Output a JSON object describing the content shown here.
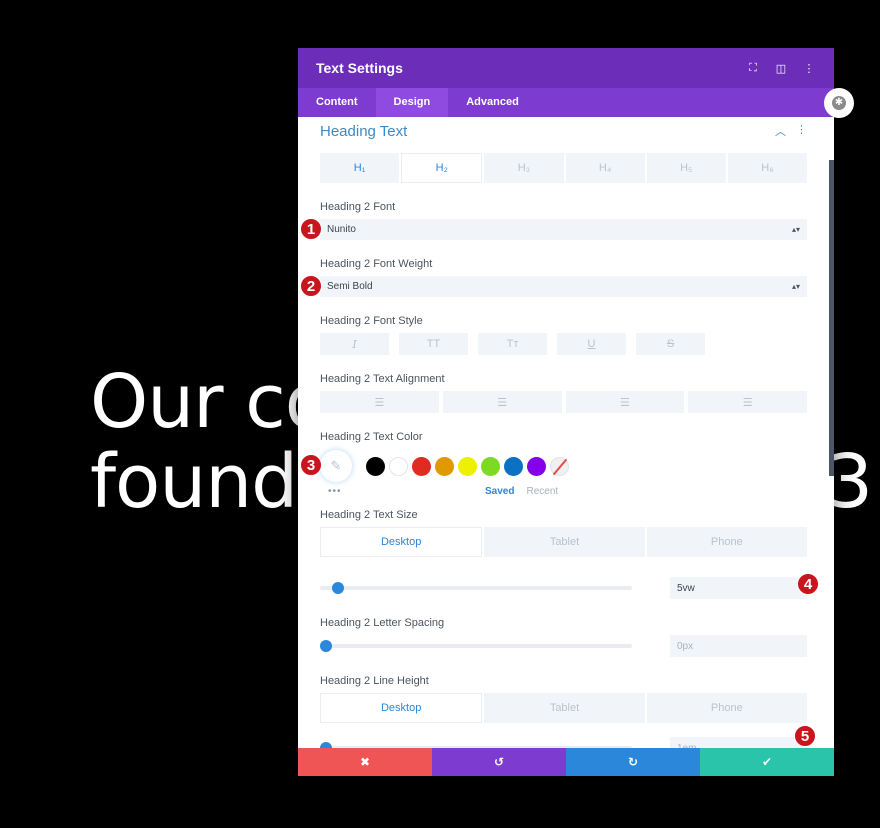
{
  "background": {
    "heading_line1": "Our co",
    "heading_line2": "found",
    "heading_right": "3"
  },
  "modal": {
    "title": "Text Settings",
    "header_icons": [
      "expand-icon",
      "split-view-icon",
      "more-vertical-icon"
    ],
    "tabs": [
      {
        "label": "Content",
        "active": false
      },
      {
        "label": "Design",
        "active": true
      },
      {
        "label": "Advanced",
        "active": false
      }
    ],
    "section": {
      "title": "Heading Text",
      "heading_tabs": [
        "H₁",
        "H₂",
        "H₃",
        "H₄",
        "H₅",
        "H₆"
      ],
      "active_heading": "H₂"
    },
    "font": {
      "label": "Heading 2 Font",
      "value": "Nunito"
    },
    "font_weight": {
      "label": "Heading 2 Font Weight",
      "value": "Semi Bold"
    },
    "font_style": {
      "label": "Heading 2 Font Style",
      "buttons": [
        "I",
        "TT",
        "Tт",
        "U",
        "S"
      ]
    },
    "text_alignment": {
      "label": "Heading 2 Text Alignment",
      "buttons": [
        "align-left",
        "align-center",
        "align-right",
        "align-justify"
      ]
    },
    "text_color": {
      "label": "Heading 2 Text Color",
      "swatches": [
        "#000000",
        "#ffffff",
        "#e02b20",
        "#e09900",
        "#edf000",
        "#7cda24",
        "#0c71c3",
        "#8300e9"
      ],
      "more": "•••",
      "saved_label": "Saved",
      "recent_label": "Recent"
    },
    "text_size": {
      "label": "Heading 2 Text Size",
      "device_tabs": [
        "Desktop",
        "Tablet",
        "Phone"
      ],
      "active_device": "Desktop",
      "value": "5vw",
      "slider_fraction": 0.04
    },
    "letter_spacing": {
      "label": "Heading 2 Letter Spacing",
      "value": "0px",
      "slider_fraction": 0
    },
    "line_height": {
      "label": "Heading 2 Line Height",
      "device_tabs": [
        "Desktop",
        "Tablet",
        "Phone"
      ],
      "active_device": "Desktop",
      "value": "1em",
      "slider_fraction": 0
    },
    "footer": {
      "cancel_icon": "✖",
      "undo_icon": "↺",
      "redo_icon": "↻",
      "save_icon": "✔",
      "colors": {
        "cancel": "#ef5555",
        "undo": "#7e3bd0",
        "redo": "#2b87da",
        "save": "#29c4a9"
      }
    }
  },
  "badges": [
    "1",
    "2",
    "3",
    "4",
    "5"
  ],
  "colors": {
    "header": "#6c2eb9",
    "tabs": "#7d3bcf",
    "accent": "#2b87da",
    "badge": "#c8161e"
  }
}
